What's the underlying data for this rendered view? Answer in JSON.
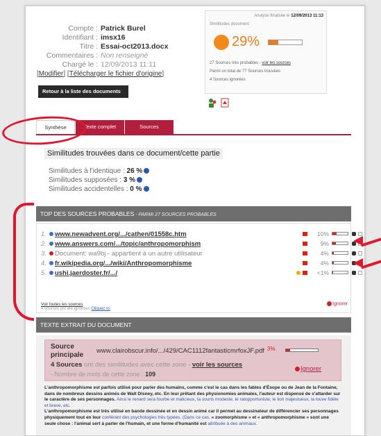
{
  "meta": {
    "compte_label": "Compte :",
    "compte": "Patrick Burel",
    "id_label": "Identifiant :",
    "id": "imsx16",
    "titre_label": "Titre :",
    "titre": "Essai-oct2013.docx",
    "comment_label": "Commentaires :",
    "comment": "Non renseigné",
    "charge_label": "Chargé le :",
    "charge": "12/09/2013 11:11",
    "modifier": "Modifier",
    "telecharger": "Télécharger le fichier d'origine",
    "back": "Retour à la liste des documents"
  },
  "analysis": {
    "date_label": "Analyse finalisée le",
    "date": "12/09/2013 11:13",
    "sim_label": "Similitudes document",
    "percent": "29%",
    "percent_value": 0.29,
    "line1": "27 Sources très probables - ",
    "line1_link": "voir les sources",
    "line2": "Parmi un total de 77 Sources trouvées",
    "line3": "4 Sources ignorées"
  },
  "tabs": [
    "Synthèse",
    "Texte complet",
    "Sources"
  ],
  "synth": {
    "title": "Similitudes trouvées dans ce document/cette partie",
    "identique_label": "Similitudes à l'identique :",
    "identique": "26 %",
    "supposees_label": "Similitudes supposées :",
    "supposees": "3 %",
    "accidentelles_label": "Similitudes accidentelles :",
    "accidentelles": "0 %"
  },
  "top": {
    "header": "TOP DES SOURCES PROBABLES",
    "header_sub": " - PARMI 27 SOURCES PROBABLES",
    "items": [
      {
        "n": "1.",
        "label": "www.newadvent.org/.../cathen/01558c.htm",
        "pct": "10%",
        "value": 0.1
      },
      {
        "n": "2.",
        "label": "www.answers.com/.../topic/anthropomorphism",
        "pct": "9%",
        "value": 0.09
      },
      {
        "n": "3.",
        "label": "Document: wa9bj - appartient à un autre utilisateur",
        "pct": "4%",
        "value": 0.04
      },
      {
        "n": "4.",
        "label": "fr.wikipedia.org/.../wiki/Anthropomorphisme",
        "pct": "4%",
        "value": 0.04
      },
      {
        "n": "5.",
        "label": "ushi.jaerdoster.fr/.../",
        "pct": "<1%",
        "value": 0.01
      }
    ],
    "see_all": "Voir toutes les sources",
    "ignored_text": "4 sources ont été ignorées ",
    "ignored_link": "Cliquez ici",
    "ignore": "Ignorer"
  },
  "extract": {
    "header": "TEXTE EXTRAIT DU DOCUMENT",
    "principal_label": "Source principale",
    "url": "www.clairobscur.info/.../429/CAC1112fantasticmrfoxJF.pdf",
    "pct": "3%",
    "sources_count": "4 Sources",
    "sources_mid": " ont des similitudes avec cette zone - ",
    "sources_link": "voir les sources",
    "words_label": "- Nombre de mots de cette zone : ",
    "words": "109",
    "ignore": "Ignorer",
    "p1": "L'anthropomorphisme est parfois utilisé pour parler des humains, comme c'est le cas dans les fables d'Ésope ou de Jean de la Fontaine, dans de nombreux dessins animés de Walt Disney, etc. En leur prêtant des physionomies animales, l'auteur est dispensé de s'attarder sur le caractère de ses personnages. ",
    "p1_hl": "Ainsi le renard sera fourbe et malicieux, la souris modeste, le ratopportuniste, le lion majestueux, la louve fidèle et brave, etc.",
    "p2": "L'anthropomorphisme est très utilisé en bande dessinée et en dessin animé car il permet au dessinateur de différencier ses personnages physiquement tout en leur ",
    "p2_hl": "conférant des psychologies très typées. (Dans ce cas,",
    "p3": " « zoomorphisme » et « anthropomorphisme » sont une seule chose : l'animal sert à parler de l'humain, et une forme d'humanité est ",
    "p3_hl": "attribuée à des animaux."
  }
}
